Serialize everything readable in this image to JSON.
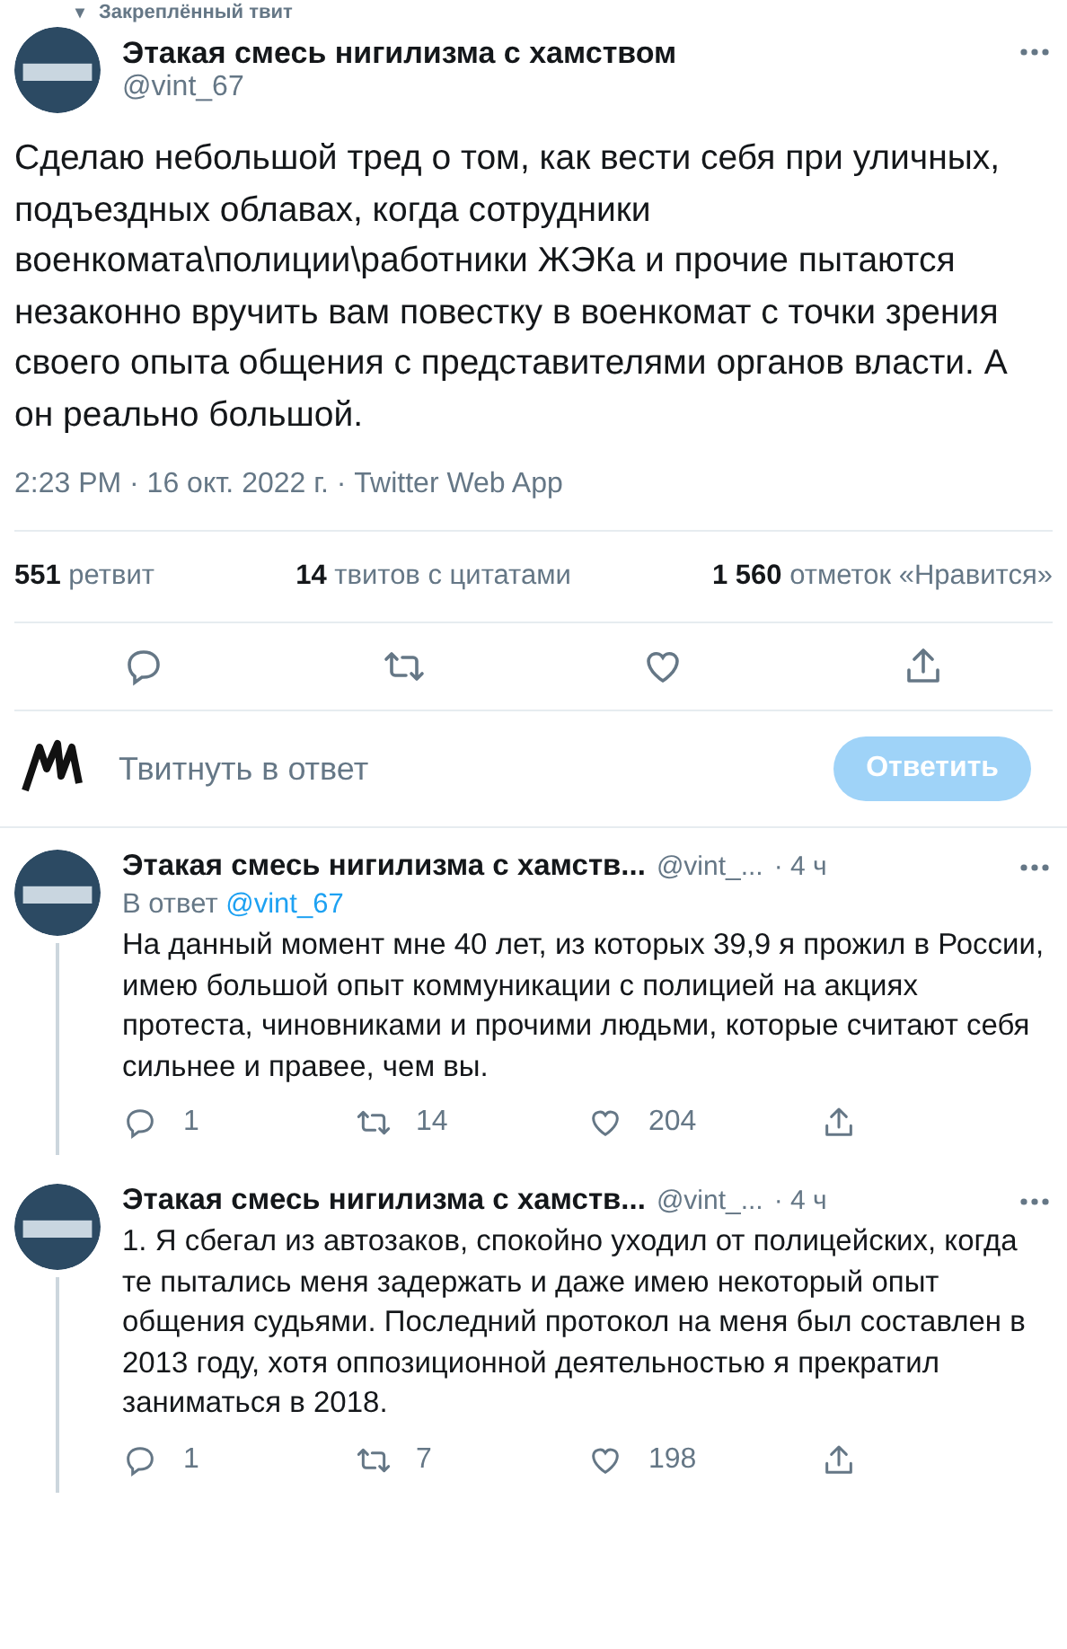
{
  "pinned_label": "Закреплённый твит",
  "tweet": {
    "author": "Этакая смесь нигилизма с хамством",
    "handle": "@vint_67",
    "text": "Сделаю небольшой тред о том, как вести себя при уличных, подъездных облавах, когда сотрудники военкомата\\полиции\\работники ЖЭКа и прочие пытаются незаконно вручить вам повестку в военкомат с точки зрения своего опыта общения с представителями органов власти. А он реально большой.",
    "meta": "2:23 PM · 16 окт. 2022 г. · Twitter Web App",
    "stats": [
      {
        "count": "551",
        "label": "ретвит"
      },
      {
        "count": "14",
        "label": "твитов с цитатами"
      },
      {
        "count": "1 560",
        "label": "отметок «Нравится»"
      }
    ]
  },
  "composer": {
    "placeholder": "Твитнуть в ответ",
    "button": "Ответить",
    "disabled": true
  },
  "replies": [
    {
      "author": "Этакая смесь нигилизма с хамств...",
      "handle": "@vint_...",
      "time": "· 4 ч",
      "reply_to_label": "В ответ",
      "reply_to": "@vint_67",
      "thread_line": true,
      "text": "На данный момент мне 40 лет, из которых 39,9 я прожил в России, имею большой опыт коммуникации с полицией на акциях протеста, чиновниками и прочими людьми, которые считают себя сильнее и правее, чем вы.",
      "replies": "1",
      "retweets": "14",
      "likes": "204"
    },
    {
      "author": "Этакая смесь нигилизма с хамств...",
      "handle": "@vint_...",
      "time": "· 4 ч",
      "thread_line": true,
      "text": "1. Я сбегал из автозаков, спокойно уходил от полицейских, когда те пытались меня задержать и даже имею некоторый опыт общения судьями. Последний протокол на меня был составлен в 2013 году, хотя оппозиционной деятельностью я прекратил заниматься в 2018.",
      "replies": "1",
      "retweets": "7",
      "likes": "198"
    }
  ]
}
